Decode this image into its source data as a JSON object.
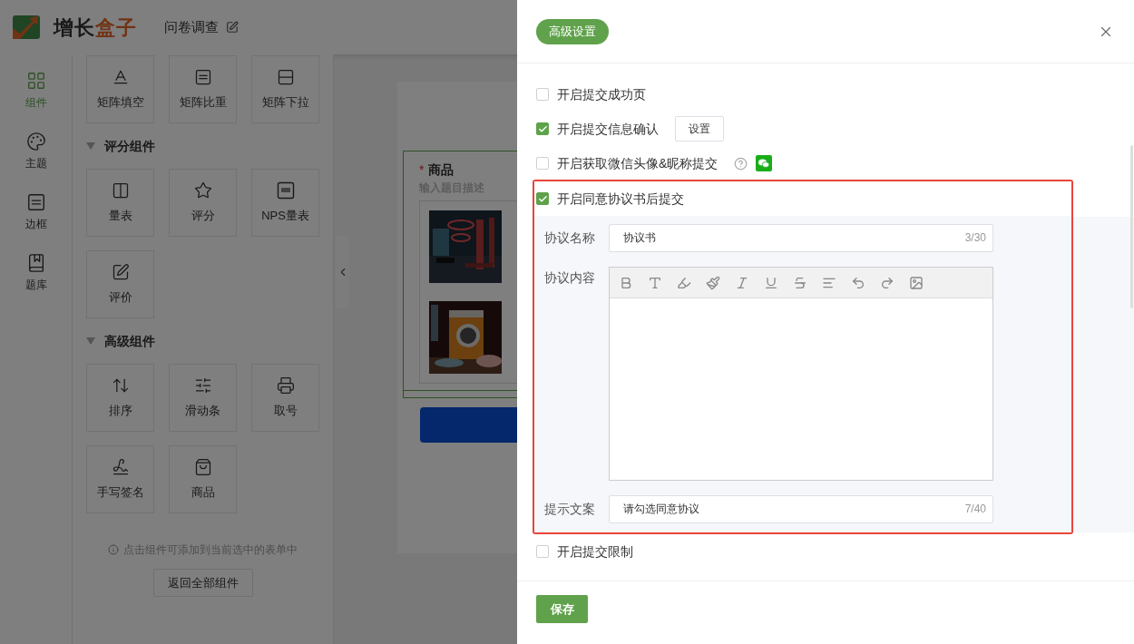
{
  "header": {
    "logo_part_1": "增长",
    "logo_part_2": "盒子",
    "title": "问卷调查"
  },
  "rail": [
    {
      "label": "组件",
      "selected": true
    },
    {
      "label": "主题",
      "selected": false
    },
    {
      "label": "边框",
      "selected": false
    },
    {
      "label": "题库",
      "selected": false
    }
  ],
  "component_panel": {
    "top_items": [
      "矩阵填空",
      "矩阵比重",
      "矩阵下拉"
    ],
    "sections": [
      {
        "title": "评分组件",
        "expanded": true,
        "items": [
          "量表",
          "评分",
          "NPS量表",
          "评价"
        ]
      },
      {
        "title": "高级组件",
        "expanded": true,
        "items": [
          "排序",
          "滑动条",
          "取号",
          "手写签名",
          "商品"
        ]
      }
    ],
    "hint": "点击组件可添加到当前选中的表单中",
    "reset_button": "返回全部组件"
  },
  "canvas": {
    "question": {
      "required_mark": "*",
      "title": "商品",
      "description_placeholder": "输入题目描述"
    }
  },
  "drawer": {
    "title": "高级设置",
    "options": [
      {
        "kind": "plain",
        "label": "开启提交成功页",
        "checked": false
      },
      {
        "kind": "button",
        "label": "开启提交信息确认",
        "checked": true,
        "button": "设置"
      },
      {
        "kind": "help",
        "label": "开启获取微信头像&昵称提交",
        "checked": false
      },
      {
        "kind": "agreement",
        "label": "开启同意协议书后提交",
        "checked": true,
        "name_field": {
          "label": "协议名称",
          "value": "协议书",
          "counter": "3/30"
        },
        "content_field": {
          "label": "协议内容"
        },
        "prompt_field": {
          "label": "提示文案",
          "value": "请勾选同意协议",
          "counter": "7/40"
        }
      },
      {
        "kind": "plain",
        "label": "开启提交限制",
        "checked": false
      }
    ],
    "save_button": "保存"
  }
}
